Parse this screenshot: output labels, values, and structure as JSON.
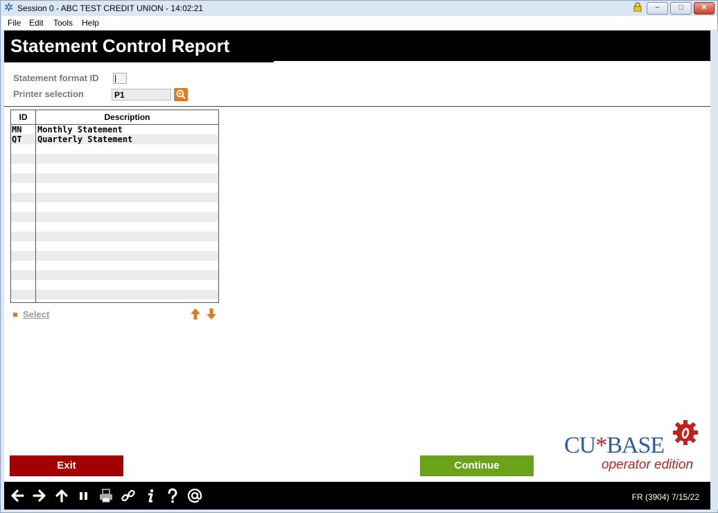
{
  "window": {
    "title": "Session 0  - ABC TEST CREDIT UNION - 14:02:21",
    "controls": {
      "minimize": "−",
      "maximize": "□",
      "close": "✕"
    }
  },
  "menu": [
    "File",
    "Edit",
    "Tools",
    "Help"
  ],
  "page": {
    "title": "Statement Control Report",
    "statement_format_label": "Statement format ID",
    "statement_format_value": "",
    "printer_label": "Printer selection",
    "printer_value": "P1"
  },
  "grid": {
    "columns": [
      "ID",
      "Description"
    ],
    "rows": [
      {
        "id": "MN",
        "desc": "Monthly Statement"
      },
      {
        "id": "QT",
        "desc": "Quarterly Statement"
      }
    ]
  },
  "actions": {
    "select_label": "Select",
    "exit_label": "Exit",
    "continue_label": "Continue"
  },
  "brand": {
    "line1_a": "CU",
    "line1_star": "*",
    "line1_b": "BASE",
    "line2": "operator edition"
  },
  "footer": {
    "icons": [
      "back-icon",
      "forward-icon",
      "up-icon",
      "pause-icon",
      "print-icon",
      "link-icon",
      "info-icon",
      "help-icon",
      "at-icon"
    ],
    "status": "FR (3904) 7/15/22"
  },
  "colors": {
    "header_bg": "#000000",
    "accent_orange": "#e07a20",
    "exit_red": "#a50000",
    "continue_green": "#6aa319",
    "brand_blue": "#2b5aa6",
    "brand_red": "#c32020"
  }
}
